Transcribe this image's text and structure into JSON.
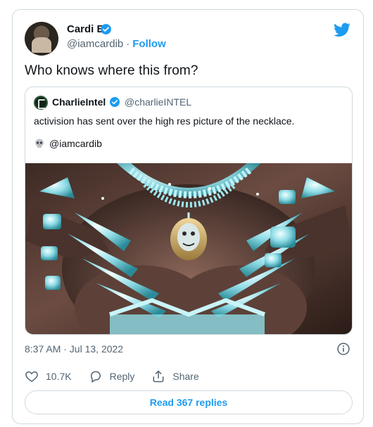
{
  "tweet": {
    "author": {
      "name": "Cardi B",
      "handle": "@iamcardib",
      "separator": "·",
      "follow_label": "Follow"
    },
    "text": "Who knows where this from?",
    "quote": {
      "name": "CharlieIntel",
      "handle": "@charlieINTEL",
      "text": "activision has sent over the high res picture of the necklace.",
      "mention": "@iamcardib"
    },
    "timestamp": "8:37 AM · Jul 13, 2022",
    "actions": {
      "likes": "10.7K",
      "reply_label": "Reply",
      "share_label": "Share"
    },
    "read_replies_label": "Read 367 replies"
  },
  "icons": {
    "verified": "verified-badge-icon",
    "brand": "twitter-bird-icon",
    "info": "info-icon",
    "like": "heart-icon",
    "reply": "reply-bubble-icon",
    "share": "share-icon",
    "emoji": "skull-icon"
  },
  "colors": {
    "accent": "#1d9bf0",
    "text": "#0f1419",
    "secondary": "#536471",
    "border": "#cfd9de"
  }
}
